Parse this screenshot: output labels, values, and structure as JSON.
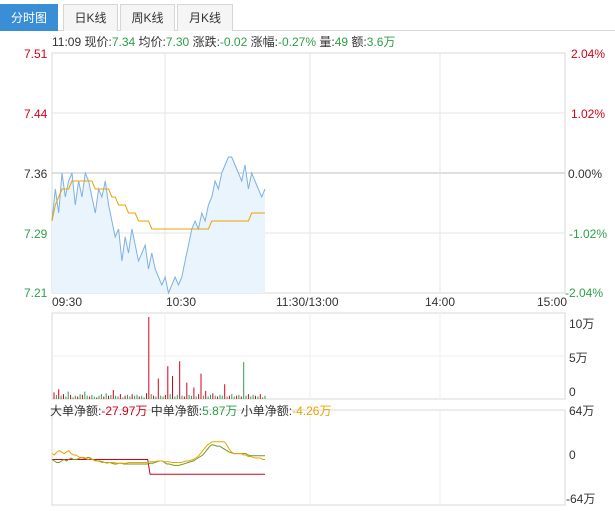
{
  "tabs": [
    {
      "label": "分时图",
      "active": true
    },
    {
      "label": "日K线",
      "active": false
    },
    {
      "label": "周K线",
      "active": false
    },
    {
      "label": "月K线",
      "active": false
    }
  ],
  "quote": {
    "time": "11:09",
    "price_label": "现价:",
    "price": "7.34",
    "avg_label": "均价:",
    "avg": "7.30",
    "change_label": "涨跌:",
    "change": "-0.02",
    "pct_label": "涨幅:",
    "pct": "-0.27%",
    "vol_label": "量:",
    "vol": "49",
    "amt_label": "额:",
    "amt": "3.6万"
  },
  "price_axis": {
    "left_ticks": [
      "7.51",
      "7.44",
      "7.36",
      "7.29",
      "7.21"
    ],
    "right_ticks": [
      "2.04%",
      "1.02%",
      "0.00%",
      "-1.02%",
      "-2.04%"
    ]
  },
  "time_axis": [
    "09:30",
    "10:30",
    "11:30/13:00",
    "14:00",
    "15:00"
  ],
  "volume_axis": [
    "10万",
    "5万",
    "0"
  ],
  "flow": {
    "big_label": "大单净额:",
    "big_value": "-27.97万",
    "mid_label": "中单净额:",
    "mid_value": "5.87万",
    "small_label": "小单净额:",
    "small_value": "-4.26万",
    "axis": [
      "64万",
      "0",
      "-64万"
    ]
  },
  "colors": {
    "up": "#d0021b",
    "down": "#2e9e4a",
    "price_line": "#7fb2e0",
    "avg_line": "#e8a400",
    "accent": "#3a8ed6"
  },
  "chart_data": {
    "type": "line",
    "x_label_times": [
      "09:30",
      "10:30",
      "11:30/13:00",
      "14:00",
      "15:00"
    ],
    "ylim": [
      7.21,
      7.51
    ],
    "series": [
      {
        "values": [
          7.3,
          7.34,
          7.31,
          7.36,
          7.33,
          7.35,
          7.36,
          7.32,
          7.35,
          7.33,
          7.36,
          7.35,
          7.33,
          7.31,
          7.34,
          7.33,
          7.35,
          7.32,
          7.3,
          7.28,
          7.29,
          7.25,
          7.28,
          7.26,
          7.29,
          7.27,
          7.25,
          7.26,
          7.27,
          7.24,
          7.26,
          7.24,
          7.23,
          7.22,
          7.23,
          7.21,
          7.22,
          7.23,
          7.22,
          7.23,
          7.25,
          7.27,
          7.29,
          7.3,
          7.29,
          7.31,
          7.3,
          7.32,
          7.33,
          7.35,
          7.34,
          7.36,
          7.37,
          7.38,
          7.38,
          7.37,
          7.36,
          7.35,
          7.37,
          7.34,
          7.36,
          7.35,
          7.34,
          7.33,
          7.34
        ]
      },
      {
        "values": [
          7.3,
          7.32,
          7.33,
          7.34,
          7.34,
          7.34,
          7.35,
          7.35,
          7.35,
          7.35,
          7.35,
          7.35,
          7.35,
          7.34,
          7.34,
          7.34,
          7.34,
          7.34,
          7.33,
          7.33,
          7.32,
          7.32,
          7.32,
          7.31,
          7.31,
          7.31,
          7.3,
          7.3,
          7.3,
          7.3,
          7.29,
          7.29,
          7.29,
          7.29,
          7.29,
          7.29,
          7.29,
          7.29,
          7.29,
          7.29,
          7.29,
          7.29,
          7.29,
          7.29,
          7.29,
          7.29,
          7.29,
          7.29,
          7.3,
          7.3,
          7.3,
          7.3,
          7.3,
          7.3,
          7.3,
          7.3,
          7.3,
          7.3,
          7.3,
          7.3,
          7.31,
          7.31,
          7.31,
          7.31,
          7.31
        ]
      }
    ],
    "volume": [
      0.8,
      0.5,
      1.2,
      0.4,
      0.6,
      0.3,
      0.9,
      0.5,
      0.2,
      0.4,
      0.3,
      0.6,
      0.5,
      0.9,
      0.4,
      0.3,
      0.5,
      0.3,
      0.2,
      0.4,
      0.6,
      0.3,
      0.7,
      0.4,
      0.5,
      1.1,
      0.4,
      0.3,
      0.6,
      0.2,
      0.4,
      0.5,
      0.3,
      0.6,
      0.4,
      0.5,
      0.3,
      0.4,
      0.2,
      0.7,
      10.0,
      0.6,
      0.4,
      0.3,
      2.5,
      0.4,
      0.3,
      0.5,
      4.0,
      0.6,
      2.8,
      0.3,
      0.5,
      4.6,
      0.4,
      0.3,
      2.0,
      0.5,
      0.4,
      1.4,
      0.3,
      0.6,
      3.1,
      0.4,
      1.0,
      0.3,
      0.5,
      0.7,
      0.4,
      0.3,
      0.5,
      0.4,
      1.8,
      0.3,
      0.4,
      0.6,
      0.3,
      0.4,
      0.5,
      0.3,
      4.5,
      0.4,
      0.6,
      0.3,
      0.5,
      0.4,
      0.3,
      0.6,
      0.2,
      0.4
    ],
    "volume_up": [
      1,
      0,
      1,
      0,
      1,
      0,
      0,
      1,
      0,
      0,
      1,
      0,
      1,
      0,
      0,
      1,
      0,
      0,
      1,
      0,
      0,
      1,
      0,
      1,
      0,
      1,
      0,
      0,
      1,
      0,
      1,
      0,
      0,
      1,
      0,
      0,
      1,
      0,
      0,
      1,
      1,
      0,
      1,
      0,
      1,
      0,
      0,
      1,
      1,
      0,
      1,
      0,
      0,
      1,
      0,
      1,
      1,
      0,
      0,
      1,
      0,
      1,
      1,
      0,
      1,
      0,
      0,
      1,
      0,
      1,
      0,
      0,
      1,
      0,
      1,
      0,
      0,
      1,
      0,
      1,
      0,
      0,
      1,
      0,
      0,
      1,
      0,
      1,
      0,
      0
    ],
    "flow_series": [
      {
        "values": [
          0,
          0,
          0,
          0,
          0,
          0,
          0,
          0,
          0,
          0,
          0,
          0,
          0,
          0,
          0,
          0,
          0,
          0,
          0,
          0,
          0,
          0,
          0,
          0,
          0,
          0,
          0,
          0,
          0,
          0,
          0,
          0,
          0,
          0,
          0,
          0,
          0,
          0,
          0,
          0,
          0,
          -20,
          -20,
          -20,
          -20,
          -20,
          -20,
          -20,
          -20,
          -20,
          -20,
          -20,
          -20,
          -20,
          -20,
          -20,
          -20,
          -20,
          -20,
          -20,
          -20,
          -20,
          -20,
          -20,
          -20,
          -20,
          -20,
          -20,
          -20,
          -20,
          -20,
          -20,
          -20,
          -20,
          -20,
          -20,
          -20,
          -20,
          -20,
          -20,
          -20,
          -20,
          -20,
          -20,
          -20,
          -20,
          -20,
          -20,
          -20,
          -20
        ]
      },
      {
        "values": [
          0,
          -2,
          -4,
          -4,
          -2,
          0,
          -2,
          0,
          2,
          0,
          0,
          1,
          3,
          2,
          1,
          3,
          2,
          0,
          -1,
          -2,
          -2,
          -3,
          -4,
          -4,
          -4,
          -5,
          -6,
          -6,
          -5,
          -5,
          -6,
          -6,
          -6,
          -6,
          -6,
          -6,
          -6,
          -6,
          -6,
          -6,
          -6,
          -5,
          -5,
          -4,
          -3,
          -2,
          -2,
          -4,
          -6,
          -6,
          -7,
          -8,
          -8,
          -8,
          -7,
          -6,
          -5,
          -4,
          -3,
          -2,
          0,
          2,
          4,
          6,
          10,
          14,
          18,
          20,
          19,
          18,
          18,
          16,
          14,
          12,
          10,
          9,
          8,
          8,
          8,
          8,
          8,
          8,
          6,
          5,
          5,
          5,
          5,
          5,
          5,
          5
        ]
      },
      {
        "values": [
          8,
          6,
          10,
          12,
          10,
          8,
          10,
          12,
          8,
          6,
          6,
          4,
          2,
          3,
          2,
          0,
          1,
          0,
          -2,
          -2,
          -3,
          -4,
          -4,
          -5,
          -4,
          -4,
          -4,
          -5,
          -5,
          -5,
          -5,
          -5,
          -4,
          -4,
          -4,
          -4,
          -4,
          -4,
          -4,
          -4,
          -4,
          -3,
          -3,
          -3,
          -2,
          -2,
          -2,
          -3,
          -3,
          -3,
          -4,
          -4,
          -4,
          -4,
          -4,
          -3,
          -2,
          -2,
          -1,
          0,
          2,
          4,
          8,
          12,
          16,
          20,
          22,
          24,
          24,
          24,
          24,
          24,
          24,
          20,
          14,
          10,
          8,
          8,
          8,
          8,
          6,
          6,
          4,
          4,
          3,
          2,
          2,
          2,
          0,
          0
        ]
      }
    ]
  }
}
